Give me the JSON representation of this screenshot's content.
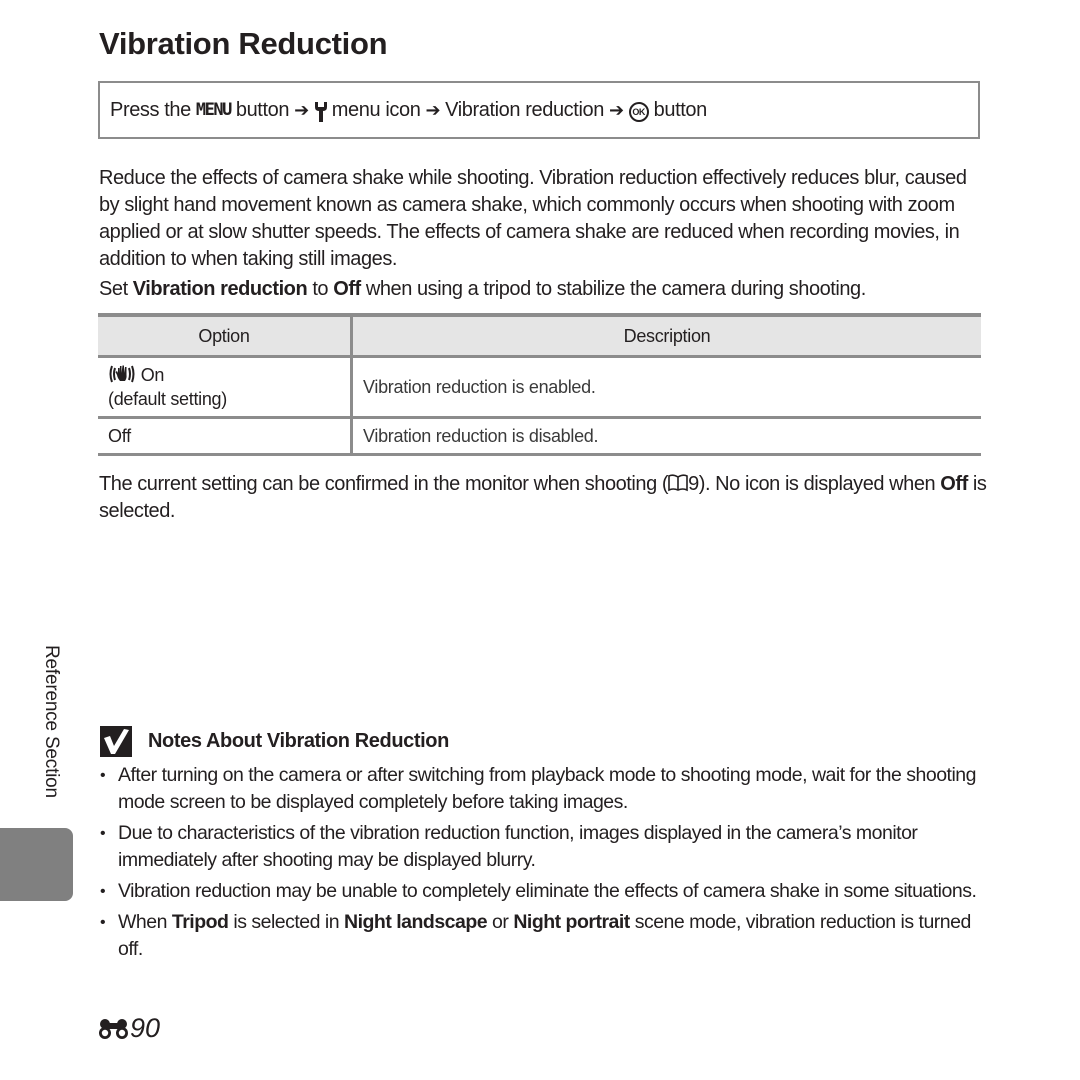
{
  "page": {
    "title": "Vibration Reduction",
    "navigation_path": {
      "prefix": "Press the",
      "menu_button": "MENU",
      "after_menu": "button",
      "after_menu_arrow": "➔",
      "menu_icon_label": "menu icon",
      "arrow2": "➔",
      "item": "Vibration reduction",
      "arrow3": "➔",
      "ok_button_glyph": "OK",
      "suffix": "button",
      "icons": [
        "wrench-setup-icon",
        "ok-button-icon"
      ]
    },
    "intro_paragraph": "Reduce the effects of camera shake while shooting. Vibration reduction effectively reduces blur, caused by slight hand movement known as camera shake, which commonly occurs when shooting with zoom applied or at slow shutter speeds. The effects of camera shake are reduced when recording movies, in addition to when taking still images.",
    "tripod_paragraph": {
      "t1": "Set ",
      "b1": "Vibration reduction",
      "t2": " to ",
      "b2": "Off",
      "t3": " when using a tripod to stabilize the camera during shooting."
    },
    "options_table": {
      "headers": [
        "Option",
        "Description"
      ],
      "rows": [
        {
          "icon": "vibration-reduction-hand-icon",
          "option": "On",
          "option_note": "(default setting)",
          "description": "Vibration reduction is enabled."
        },
        {
          "option": "Off",
          "description": "Vibration reduction is disabled."
        }
      ]
    },
    "confirm_paragraph": {
      "t1": "The current setting can be confirmed in the monitor when shooting (",
      "ref_icon": "book-reference-icon",
      "ref_page": "9",
      "t2": "). No icon is displayed when ",
      "b1": "Off",
      "t3": " is selected."
    },
    "side_label": "Reference Section",
    "notes": {
      "heading": "Notes About Vibration Reduction",
      "icon": "checkmark-icon",
      "items": [
        {
          "text": "After turning on the camera or after switching from playback mode to shooting mode, wait for the shooting mode screen to be displayed completely before taking images."
        },
        {
          "text": "Due to characteristics of the vibration reduction function, images displayed in the camera’s monitor immediately after shooting may be displayed blurry."
        },
        {
          "text": "Vibration reduction may be unable to completely eliminate the effects of camera shake in some situations."
        },
        {
          "t1": "When ",
          "b1": "Tripod",
          "t2": " is selected in ",
          "b2": "Night landscape",
          "t3": " or ",
          "b3": "Night portrait",
          "t4": " scene mode, vibration reduction is turned off."
        }
      ]
    },
    "page_number": "90",
    "page_number_icon": "reference-section-binoculars-icon"
  },
  "colors": {
    "text": "#231f20",
    "rule": "#8c8c8c",
    "table_header_bg": "#e5e5e5",
    "side_tab": "#808080"
  }
}
